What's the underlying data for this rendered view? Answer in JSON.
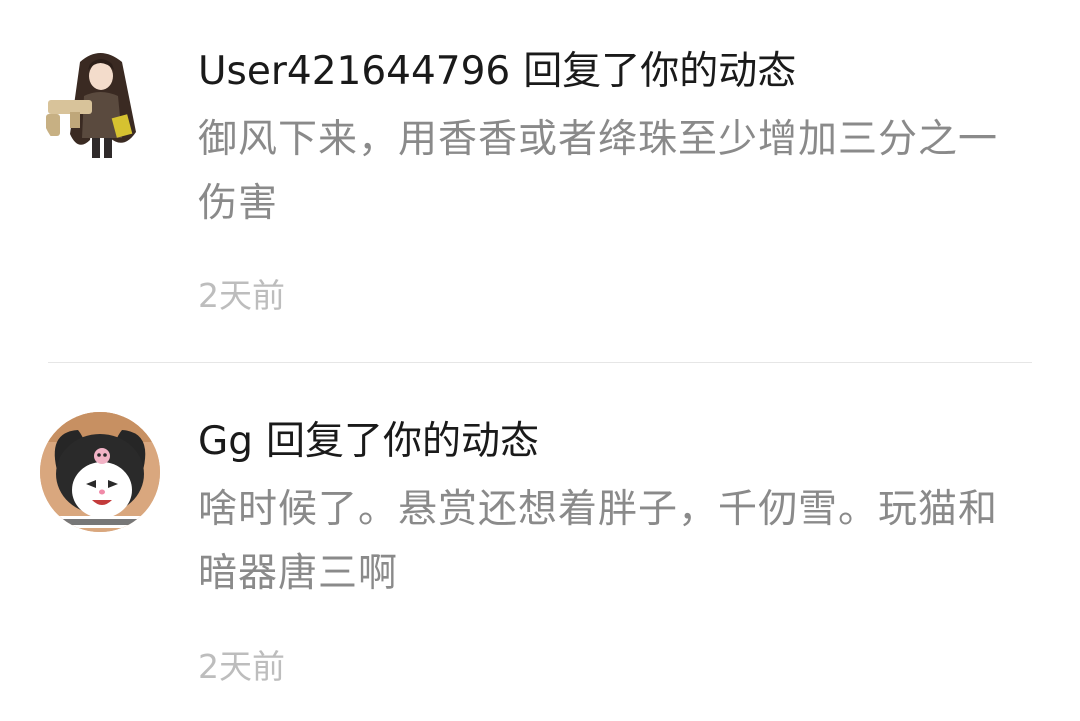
{
  "notifications": [
    {
      "user": "User421644796",
      "action": "回复了你的动态",
      "message": "御风下来，用香香或者绛珠至少增加三分之一伤害",
      "time": "2天前"
    },
    {
      "user": "Gg",
      "action": "回复了你的动态",
      "message": "啥时候了。悬赏还想着胖子，千仞雪。玩猫和暗器唐三啊",
      "time": "2天前"
    }
  ],
  "colors": {
    "title": "#1a1a1a",
    "message": "#8a8a8a",
    "time": "#bdbdbd",
    "divider": "#e6e6e6"
  }
}
